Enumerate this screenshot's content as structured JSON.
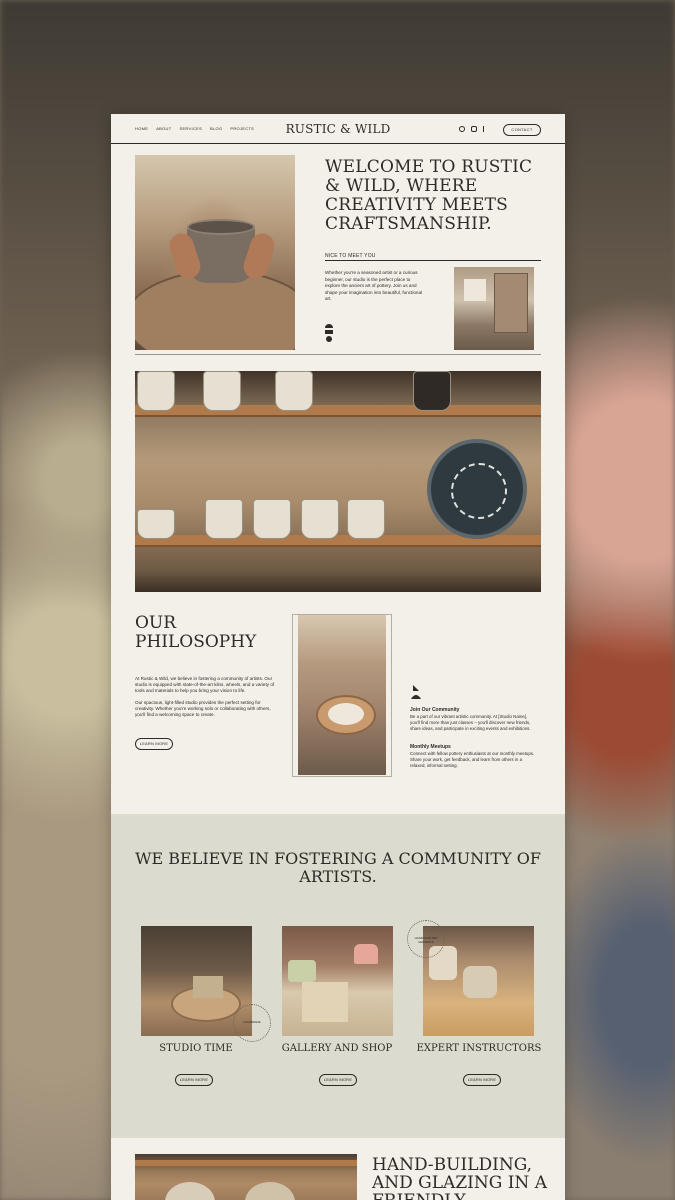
{
  "nav": {
    "links": [
      "HOME",
      "ABOUT",
      "SERVICES",
      "BLOG",
      "PROJECTS"
    ],
    "logo": "RUSTIC & WILD",
    "contact_label": "CONTACT",
    "social_icons": [
      "pinterest-icon",
      "instagram-icon",
      "tiktok-icon"
    ]
  },
  "hero": {
    "title": "WELCOME TO RUSTIC & WILD, WHERE CREATIVITY MEETS CRAFTSMANSHIP.",
    "kicker": "NICE TO MEET YOU",
    "body": "Whether you're a seasoned artist or a curious beginner, our studio is the perfect place to explore the ancient art of pottery. Join us and shape your imagination into beautiful, functional art."
  },
  "philosophy": {
    "title": "OUR PHILOSOPHY",
    "para1": "At Rustic & Wild, we believe in fostering a community of artists. Our studio is equipped with state-of-the-art kilns, wheels, and a variety of tools and materials to help you bring your vision to life.",
    "para2": "Our spacious, light-filled studio provides the perfect setting for creativity. Whether you're working solo or collaborating with others, you'll find a welcoming space to create.",
    "learn_more": "LEARN MORE",
    "side": {
      "heading1": "Join Our Community",
      "text1": "Be a part of our vibrant artistic community. At [Studio Name], you'll find more than just classes – you'll discover new friends, share ideas, and participate in exciting events and exhibitions.",
      "heading2": "Monthly Meetups",
      "text2": "Connect with fellow pottery enthusiasts at our monthly meetups. Share your work, get feedback, and learn from others in a relaxed, informal setting."
    }
  },
  "community": {
    "title": "WE BELIEVE IN FOSTERING A COMMUNITY OF ARTISTS.",
    "cards": [
      {
        "label": "STUDIO TIME",
        "button": "LEARN MORE",
        "badge": "HANDMADE"
      },
      {
        "label": "GALLERY AND SHOP",
        "button": "LEARN MORE"
      },
      {
        "label": "EXPERT INSTRUCTORS",
        "button": "LEARN MORE",
        "badge": "HANDCRAFTED CERAMICS"
      }
    ]
  },
  "next_section": {
    "title": "HAND-BUILDING, AND GLAZING IN A FRIENDLY"
  }
}
